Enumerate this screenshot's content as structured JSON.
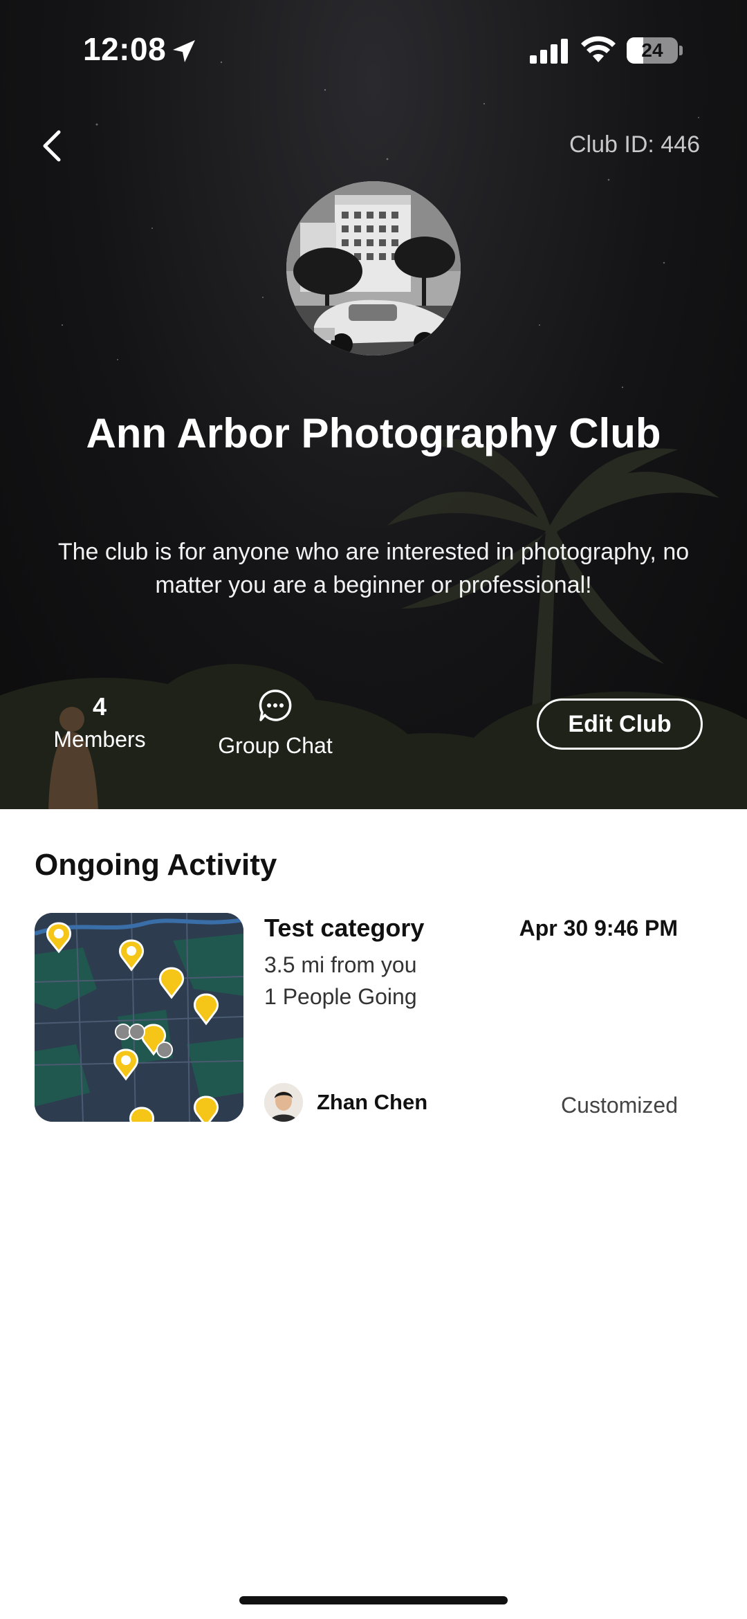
{
  "status_bar": {
    "time": "12:08",
    "battery_level": "24",
    "icons": [
      "location-arrow-icon",
      "cellular-signal-icon",
      "wifi-icon",
      "battery-icon"
    ]
  },
  "header": {
    "back_icon": "chevron-left-icon",
    "club_id": "Club ID: 446"
  },
  "club": {
    "name": "Ann Arbor Photography Club",
    "description": "The club is for anyone who are interested in photography, no matter you are a beginner or professional!",
    "members_count": "4",
    "members_label": "Members",
    "group_chat_label": "Group Chat",
    "group_chat_icon": "chat-bubble-icon",
    "edit_button": "Edit Club"
  },
  "ongoing": {
    "section_title": "Ongoing Activity",
    "activities": [
      {
        "category": "Test category",
        "distance": "3.5 mi from you",
        "going": "1 People Going",
        "datetime": "Apr 30 9:46 PM",
        "host": "Zhan Chen",
        "type": "Customized"
      }
    ]
  },
  "colors": {
    "hero_bg": "#141416",
    "text_on_dark": "#ffffff",
    "map_bg": "#2d3b4e",
    "map_pin": "#f5c518"
  }
}
